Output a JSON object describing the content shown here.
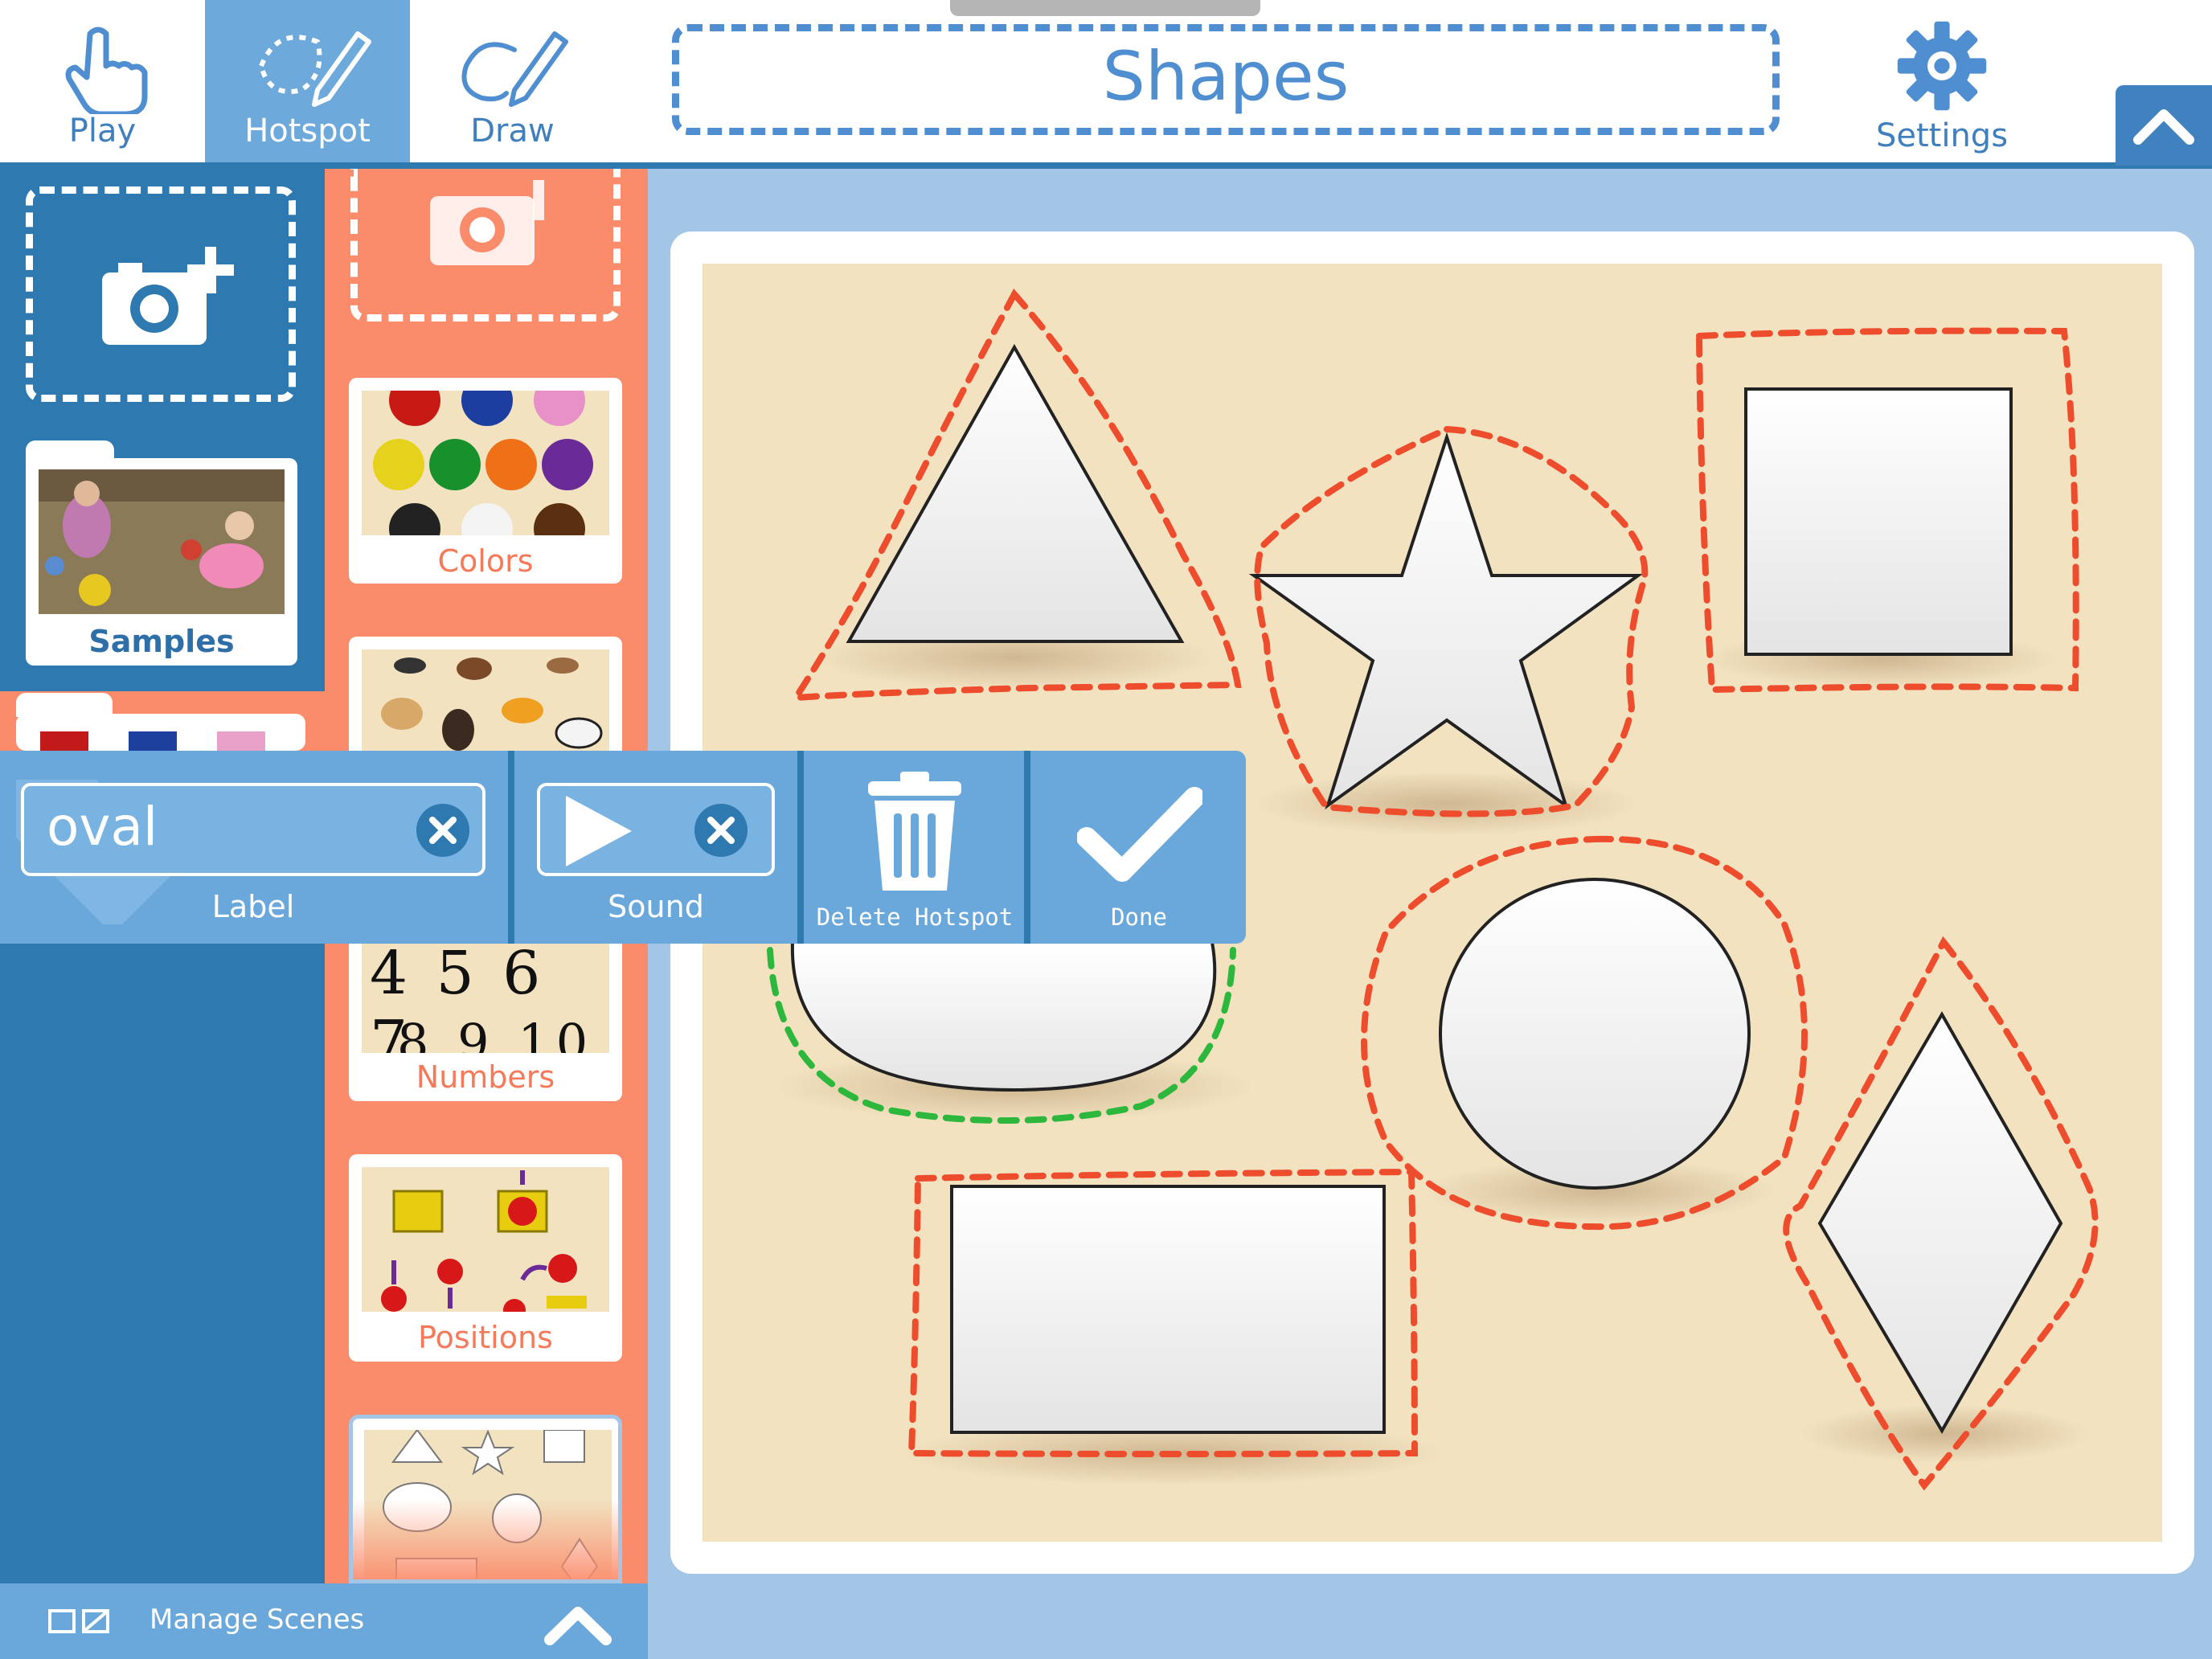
{
  "toolbar": {
    "modes": [
      {
        "label": "Play",
        "icon": "hand-pointer-icon"
      },
      {
        "label": "Hotspot",
        "icon": "hotspot-pencil-icon",
        "active": true
      },
      {
        "label": "Draw",
        "icon": "draw-pencil-icon"
      }
    ],
    "title": "Shapes",
    "settings_label": "Settings"
  },
  "sidebar": {
    "albums": [
      {
        "label": "Samples"
      }
    ]
  },
  "scenes": [
    {
      "label": "Colors"
    },
    {
      "label": "Numbers"
    },
    {
      "label": "Positions"
    }
  ],
  "numbers_thumb_text": "4 5 6 7",
  "bottom_bar": {
    "label": "Manage Scenes"
  },
  "hotspot_editor": {
    "label_value": "oval",
    "label_caption": "Label",
    "sound_caption": "Sound",
    "delete_caption": "Delete Hotspot",
    "done_caption": "Done"
  },
  "colors": {
    "accent_blue": "#2e79b0",
    "light_blue": "#6aa8dc",
    "salmon": "#fa8c6c",
    "hotspot_outline": "#ee4d2d",
    "selected_hotspot_outline": "#2db83d",
    "board": "#f2e2c0"
  }
}
